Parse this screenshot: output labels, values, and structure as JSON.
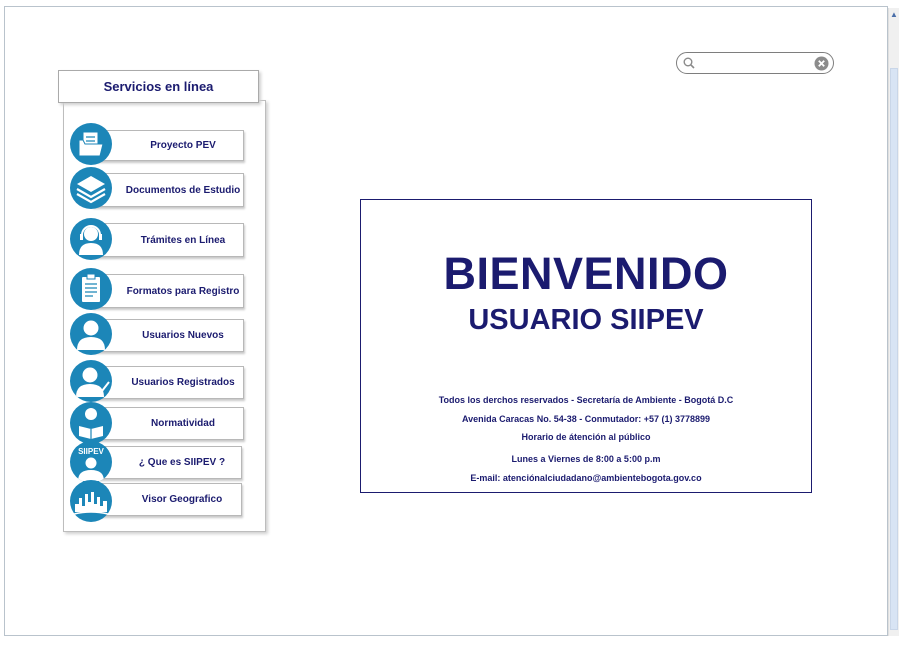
{
  "search": {
    "placeholder": "",
    "value": ""
  },
  "services": {
    "title": "Servicios en línea",
    "items": [
      {
        "label": "Proyecto PEV",
        "icon": "folder-document-icon"
      },
      {
        "label": "Documentos de Estudio",
        "icon": "stacked-layers-icon"
      },
      {
        "label": "Trámites en Línea",
        "icon": "support-agent-icon"
      },
      {
        "label": "Formatos para Registro",
        "icon": "clipboard-icon"
      },
      {
        "label": "Usuarios Nuevos",
        "icon": "user-icon"
      },
      {
        "label": "Usuarios Registrados",
        "icon": "user-check-icon"
      },
      {
        "label": "Normatividad",
        "icon": "user-reading-icon"
      },
      {
        "label": "¿ Que es SIIPEV ?",
        "icon": "siipev-user-icon",
        "badge": "SIIPEV"
      },
      {
        "label": "Visor Geografico",
        "icon": "city-skyline-icon"
      }
    ]
  },
  "welcome": {
    "title": "BIENVENIDO",
    "subtitle": "USUARIO SIIPEV",
    "rights": "Todos los derchos reservados - Secretaría de Ambiente - Bogotá D.C",
    "address": "Avenida Caracas No. 54-38 - Conmutador: +57 (1) 3778899",
    "hours_label": "Horario de átención al público",
    "hours": "Lunes a Viernes de 8:00 a 5:00 p.m",
    "email": "E-mail: atenciónalciudadano@ambientebogota.gov.co"
  }
}
